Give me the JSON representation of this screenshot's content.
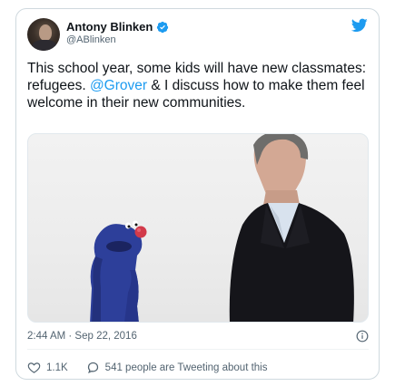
{
  "author": {
    "display_name": "Antony Blinken",
    "handle": "@ABlinken",
    "verified": true
  },
  "tweet": {
    "text_before": "This school year, some kids will have new classmates: refugees. ",
    "mention": "@Grover",
    "text_after": " & I discuss how to make them feel welcome in their new communities."
  },
  "timestamp": "2:44 AM · Sep 22, 2016",
  "actions": {
    "likes": "1.1K",
    "tweeting": "541 people are Tweeting about this"
  },
  "colors": {
    "accent": "#1d9bf0",
    "text": "#0f1419",
    "muted": "#536471",
    "border": "#cfd9de"
  },
  "icons": [
    "verified-badge-icon",
    "twitter-bird-icon",
    "info-icon",
    "heart-icon",
    "comment-icon"
  ]
}
